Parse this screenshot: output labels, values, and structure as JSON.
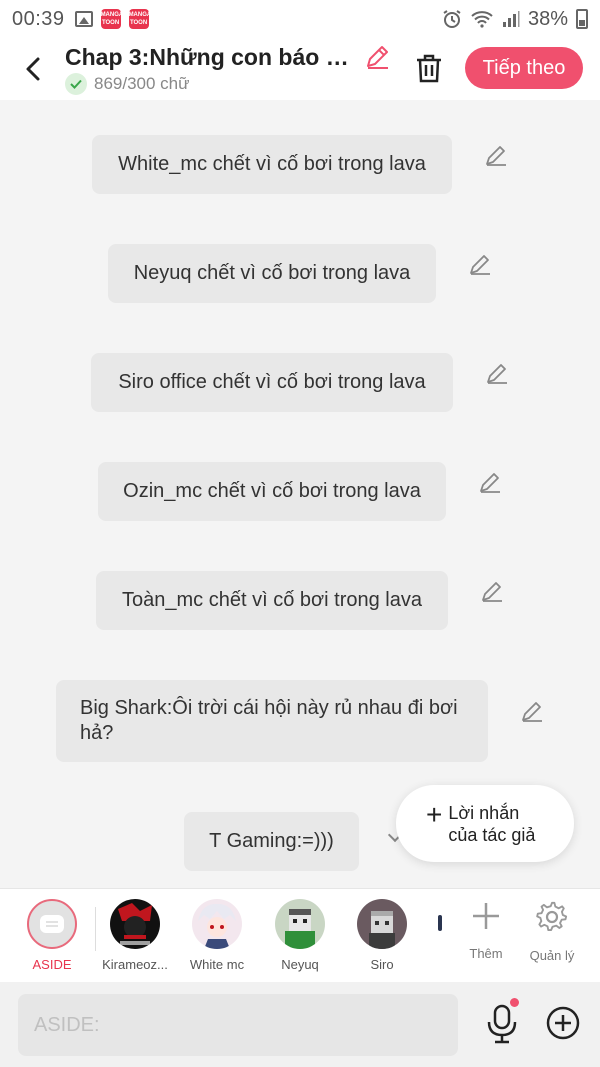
{
  "status_bar": {
    "time": "00:39",
    "app_badge_1": "MANGA TOON",
    "app_badge_2": "MANGA TOON",
    "battery": "38%"
  },
  "header": {
    "title": "Chap 3:Những con báo mớ...",
    "word_count": "869/300 chữ",
    "next_label": "Tiếp theo"
  },
  "messages": [
    "White_mc chết vì cố bơi trong lava",
    "Neyuq chết vì cố bơi trong lava",
    "Siro office chết vì cố bơi trong lava",
    "Ozin_mc chết vì cố bơi trong lava",
    "Toàn_mc chết vì cố bơi trong lava",
    "Big Shark:Ôi trời cái hội này rủ nhau đi bơi hả?",
    "T Gaming:=)))"
  ],
  "author_note": {
    "line1": "Lời nhắn",
    "line2": "của tác giả"
  },
  "characters": [
    {
      "label": "ASIDE"
    },
    {
      "label": "Kirameoz..."
    },
    {
      "label": "White mc"
    },
    {
      "label": "Neyuq"
    },
    {
      "label": "Siro"
    }
  ],
  "tools": {
    "add_label": "Thêm",
    "manage_label": "Quản lý"
  },
  "input": {
    "placeholder": "ASIDE:"
  },
  "colors": {
    "accent": "#f0506e",
    "aside_label": "#e8344e",
    "bubble": "#e8e8e8",
    "background": "#f4f4f4"
  },
  "icons": [
    "back-icon",
    "pencil-icon",
    "check-icon",
    "trash-icon",
    "plus-icon",
    "gear-icon",
    "mic-icon",
    "add-circle-icon",
    "aside-chat-icon"
  ]
}
